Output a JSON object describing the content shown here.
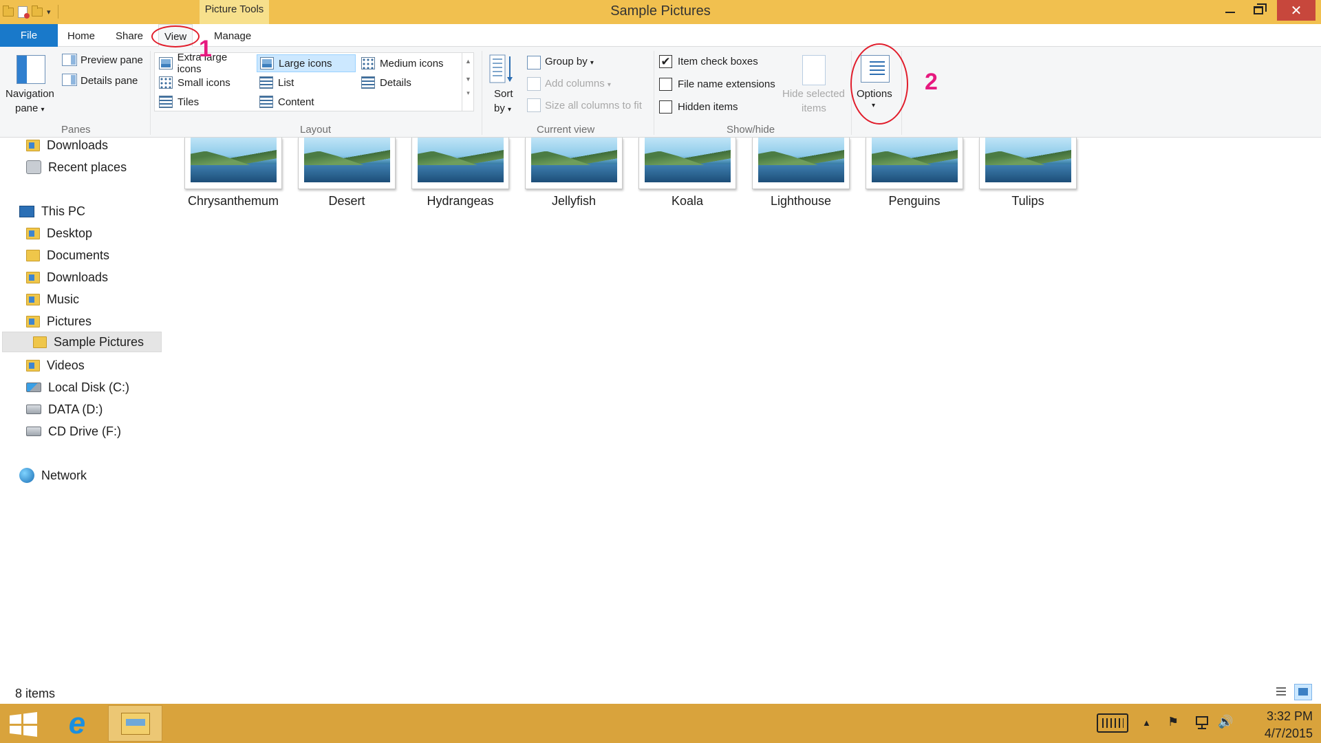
{
  "window": {
    "title": "Sample Pictures",
    "contextual_tab": "Picture Tools",
    "close_glyph": "✕"
  },
  "ribbon_tabs": {
    "file": "File",
    "home": "Home",
    "share": "Share",
    "view": "View",
    "manage": "Manage"
  },
  "annotations": {
    "step_1": "1",
    "step_2": "2",
    "ring_color": "#e11d2b",
    "number_color": "#e6197f"
  },
  "help": "?",
  "ribbon": {
    "panes": {
      "navigation_pane_line1": "Navigation",
      "navigation_pane_line2": "pane",
      "preview_pane": "Preview pane",
      "details_pane": "Details pane",
      "group_label": "Panes"
    },
    "layout": {
      "extra_large_icons": "Extra large icons",
      "large_icons": "Large icons",
      "medium_icons": "Medium icons",
      "small_icons": "Small icons",
      "list": "List",
      "details": "Details",
      "tiles": "Tiles",
      "content": "Content",
      "selected": "Large icons",
      "group_label": "Layout"
    },
    "current_view": {
      "sort_by_line1": "Sort",
      "sort_by_line2": "by",
      "group_by": "Group by",
      "add_columns": "Add columns",
      "size_all_columns": "Size all columns to fit",
      "group_label": "Current view"
    },
    "show_hide": {
      "item_check_boxes": "Item check boxes",
      "item_check_boxes_checked": "✔",
      "file_name_extensions": "File name extensions",
      "hidden_items": "Hidden items",
      "hide_selected_line1": "Hide selected",
      "hide_selected_line2": "items",
      "group_label": "Show/hide"
    },
    "options": {
      "label": "Options"
    }
  },
  "navigation": {
    "items": [
      {
        "label": "Downloads",
        "icon": "downloads-folder-icon"
      },
      {
        "label": "Recent places",
        "icon": "recent-places-icon"
      },
      {
        "label": "This PC",
        "icon": "this-pc-icon"
      },
      {
        "label": "Desktop",
        "icon": "desktop-folder-icon"
      },
      {
        "label": "Documents",
        "icon": "documents-folder-icon"
      },
      {
        "label": "Downloads",
        "icon": "downloads-folder-icon"
      },
      {
        "label": "Music",
        "icon": "music-folder-icon"
      },
      {
        "label": "Pictures",
        "icon": "pictures-folder-icon"
      },
      {
        "label": "Sample Pictures",
        "icon": "folder-icon"
      },
      {
        "label": "Videos",
        "icon": "videos-folder-icon"
      },
      {
        "label": "Local Disk (C:)",
        "icon": "local-disk-icon"
      },
      {
        "label": "DATA (D:)",
        "icon": "drive-icon"
      },
      {
        "label": "CD Drive (F:)",
        "icon": "cd-drive-icon"
      },
      {
        "label": "Network",
        "icon": "network-icon"
      }
    ],
    "selected": "Sample Pictures"
  },
  "files": [
    {
      "name": "Chrysanthemum"
    },
    {
      "name": "Desert"
    },
    {
      "name": "Hydrangeas"
    },
    {
      "name": "Jellyfish"
    },
    {
      "name": "Koala"
    },
    {
      "name": "Lighthouse"
    },
    {
      "name": "Penguins"
    },
    {
      "name": "Tulips"
    }
  ],
  "status": {
    "item_count": "8 items"
  },
  "taskbar": {
    "time": "3:32 PM",
    "date": "4/7/2015",
    "ie_glyph": "e",
    "tray_up": "▲",
    "tray_flag": "⚑",
    "tray_volume": "🔊",
    "colors": {
      "taskbar": "#d9a33c",
      "titlebar": "#f1c04f",
      "accent": "#1979ca"
    }
  }
}
